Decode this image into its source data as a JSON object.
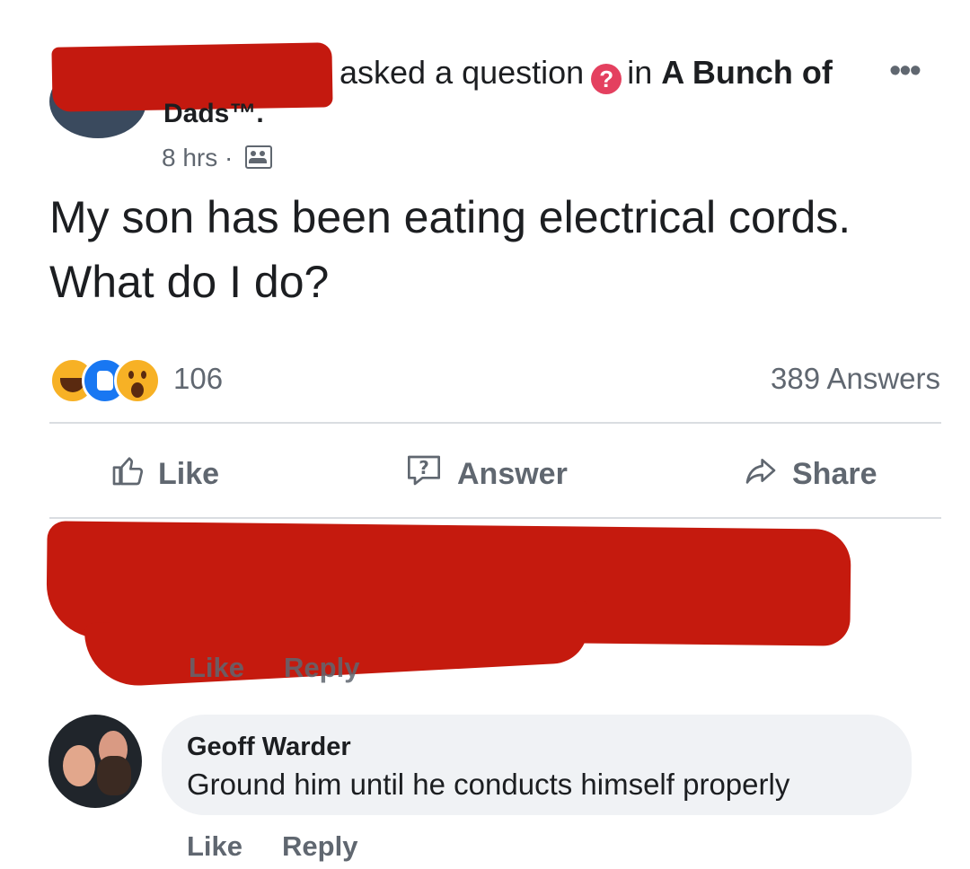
{
  "post": {
    "header": {
      "asked_text": "asked a question",
      "in_text": "in",
      "group_name_part1": "A Bunch of",
      "group_name_part2": "Dads™.",
      "time": "8 hrs",
      "separator": "·"
    },
    "question": "My son has been eating electrical cords. What do I do?",
    "reactions": {
      "icons": [
        "haha-icon",
        "like-icon",
        "wow-icon"
      ],
      "count": "106"
    },
    "answers_count": "389 Answers",
    "actions": {
      "like": "Like",
      "answer": "Answer",
      "share": "Share"
    }
  },
  "redacted_comment": {
    "like": "Like",
    "reply": "Reply"
  },
  "comment": {
    "author": "Geoff Warder",
    "text": "Ground him until he conducts himself properly",
    "like": "Like",
    "reply": "Reply"
  },
  "colors": {
    "redaction": "#c4190f",
    "muted": "#606770",
    "question_badge": "#e4405f",
    "bubble": "#f0f2f5"
  }
}
